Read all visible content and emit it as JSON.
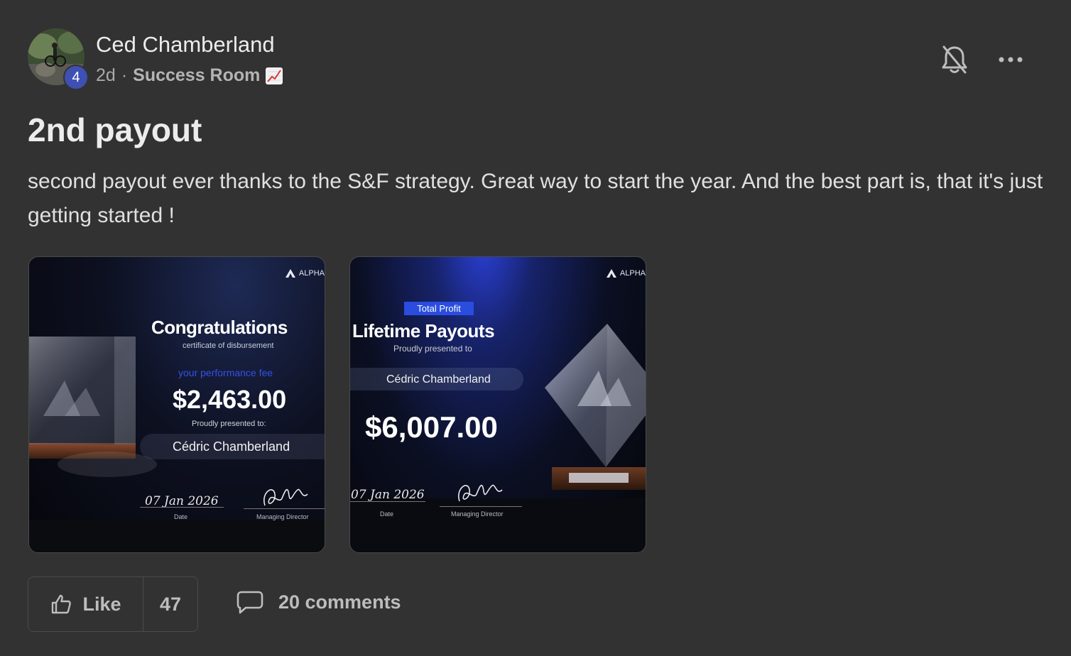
{
  "post": {
    "author": "Ced Chamberland",
    "level": "4",
    "time": "2d",
    "separator": "·",
    "category": "Success Room",
    "category_emoji": "chart-increasing-icon",
    "title": "2nd payout",
    "body": "second payout ever thanks to the S&F strategy. Great way to start the year. And the best part is, that it's just getting started !"
  },
  "header_actions": {
    "notify_icon": "bell-off-icon",
    "more_icon": "more-horizontal-icon"
  },
  "images": [
    {
      "brand": "ALPHA",
      "heading": "Congratulations",
      "subheading": "certificate of disbursement",
      "fee_label": "your performance fee",
      "amount": "$2,463.00",
      "presented": "Proudly presented to:",
      "recipient": "Cédric Chamberland",
      "date": "07 Jan 2026",
      "date_label": "Date",
      "signer_label": "Managing Director"
    },
    {
      "brand": "ALPHA",
      "tag": "Total Profit",
      "heading": "Lifetime Payouts",
      "presented": "Proudly presented to",
      "recipient": "Cédric Chamberland",
      "amount": "$6,007.00",
      "date": "07 Jan 2026",
      "date_label": "Date",
      "signer_label": "Managing Director"
    }
  ],
  "actions": {
    "like_label": "Like",
    "like_count": "47",
    "comments_label": "20 comments"
  },
  "colors": {
    "background": "#323232",
    "level_badge": "#3e50b4",
    "accent_blue": "#2a4de0"
  }
}
